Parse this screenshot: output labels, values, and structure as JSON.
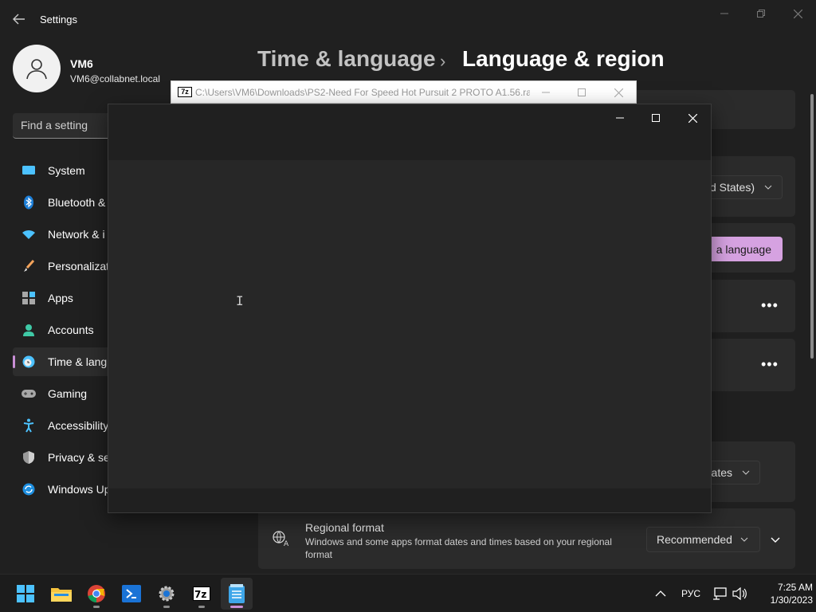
{
  "window": {
    "title": "Settings"
  },
  "profile": {
    "name": "VM6",
    "email": "VM6@collabnet.local"
  },
  "search": {
    "placeholder": "Find a setting"
  },
  "nav": [
    {
      "label": "System",
      "icon": "monitor-icon"
    },
    {
      "label": "Bluetooth &",
      "icon": "bluetooth-icon"
    },
    {
      "label": "Network & i",
      "icon": "wifi-icon"
    },
    {
      "label": "Personalizati",
      "icon": "brush-icon"
    },
    {
      "label": "Apps",
      "icon": "apps-icon"
    },
    {
      "label": "Accounts",
      "icon": "person-icon"
    },
    {
      "label": "Time & lang",
      "icon": "clock-globe-icon",
      "active": true
    },
    {
      "label": "Gaming",
      "icon": "gamepad-icon"
    },
    {
      "label": "Accessibility",
      "icon": "accessibility-icon"
    },
    {
      "label": "Privacy & se",
      "icon": "shield-icon"
    },
    {
      "label": "Windows Up",
      "icon": "update-icon"
    }
  ],
  "breadcrumb": {
    "parent": "Time & language",
    "separator": "›",
    "current": "Language & region"
  },
  "content": {
    "display_language_value": "d States)",
    "add_language_label": "a language",
    "more_options": "•••",
    "country_value": "ates",
    "regional_format": {
      "title": "Regional format",
      "description": "Windows and some apps format dates and times based on your regional format",
      "value": "Recommended"
    }
  },
  "zip_window": {
    "path": "C:\\Users\\VM6\\Downloads\\PS2-Need For Speed Hot Pursuit 2 PROTO A1.56.ra...",
    "icon_text": "7z"
  },
  "taskbar": {
    "apps": [
      "windows-start-icon",
      "file-explorer-icon",
      "chrome-icon",
      "remote-desktop-icon",
      "settings-gear-icon",
      "7zip-icon",
      "notepad-icon"
    ],
    "language": "РУС",
    "time": "7:25 AM",
    "date": "1/30/2023"
  },
  "colors": {
    "accent": "#d6a2e1",
    "background": "#202020",
    "card": "#2b2b2b"
  }
}
